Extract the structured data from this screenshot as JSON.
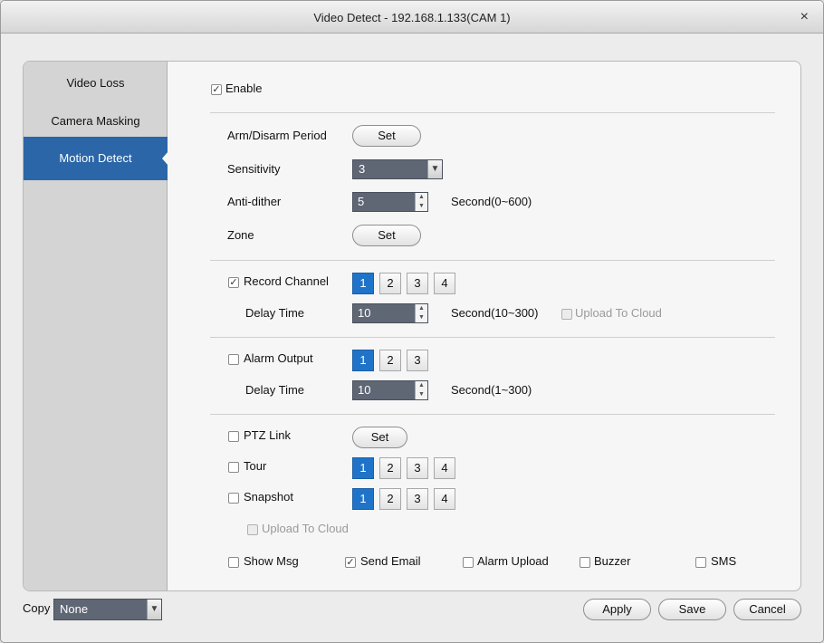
{
  "window": {
    "title": "Video Detect - 192.168.1.133(CAM 1)",
    "close": "×"
  },
  "sidebar": {
    "items": [
      {
        "label": "Video Loss"
      },
      {
        "label": "Camera Masking"
      },
      {
        "label": "Motion Detect",
        "active": true
      }
    ]
  },
  "enable": {
    "label": "Enable",
    "checked": true
  },
  "arm": {
    "label": "Arm/Disarm Period",
    "button": "Set"
  },
  "sensitivity": {
    "label": "Sensitivity",
    "value": "3"
  },
  "antidither": {
    "label": "Anti-dither",
    "value": "5",
    "unit": "Second(0~600)"
  },
  "zone": {
    "label": "Zone",
    "button": "Set"
  },
  "record": {
    "label": "Record Channel",
    "checked": true,
    "channels": [
      "1",
      "2",
      "3",
      "4"
    ],
    "selected": "1",
    "delay_label": "Delay Time",
    "delay": "10",
    "delay_unit": "Second(10~300)",
    "cloud": "Upload To Cloud"
  },
  "alarm": {
    "label": "Alarm Output",
    "checked": false,
    "channels": [
      "1",
      "2",
      "3"
    ],
    "selected": "1",
    "delay_label": "Delay Time",
    "delay": "10",
    "delay_unit": "Second(1~300)"
  },
  "ptz": {
    "label": "PTZ Link",
    "button": "Set"
  },
  "tour": {
    "label": "Tour",
    "channels": [
      "1",
      "2",
      "3",
      "4"
    ],
    "selected": "1"
  },
  "snapshot": {
    "label": "Snapshot",
    "channels": [
      "1",
      "2",
      "3",
      "4"
    ],
    "selected": "1",
    "cloud": "Upload To Cloud"
  },
  "notify": {
    "show_msg": "Show Msg",
    "send_email": "Send Email",
    "alarm_upload": "Alarm Upload",
    "buzzer": "Buzzer",
    "sms": "SMS"
  },
  "footer": {
    "copy_label": "Copy",
    "copy_value": "None",
    "apply": "Apply",
    "save": "Save",
    "cancel": "Cancel"
  },
  "icons": {
    "check": "✓",
    "dropdown": "▼",
    "spin_up": "▲",
    "spin_down": "▼"
  },
  "colors": {
    "accent": "#2a66a8",
    "selected_channel": "#1f74c9",
    "field_bg": "#5f6674"
  }
}
